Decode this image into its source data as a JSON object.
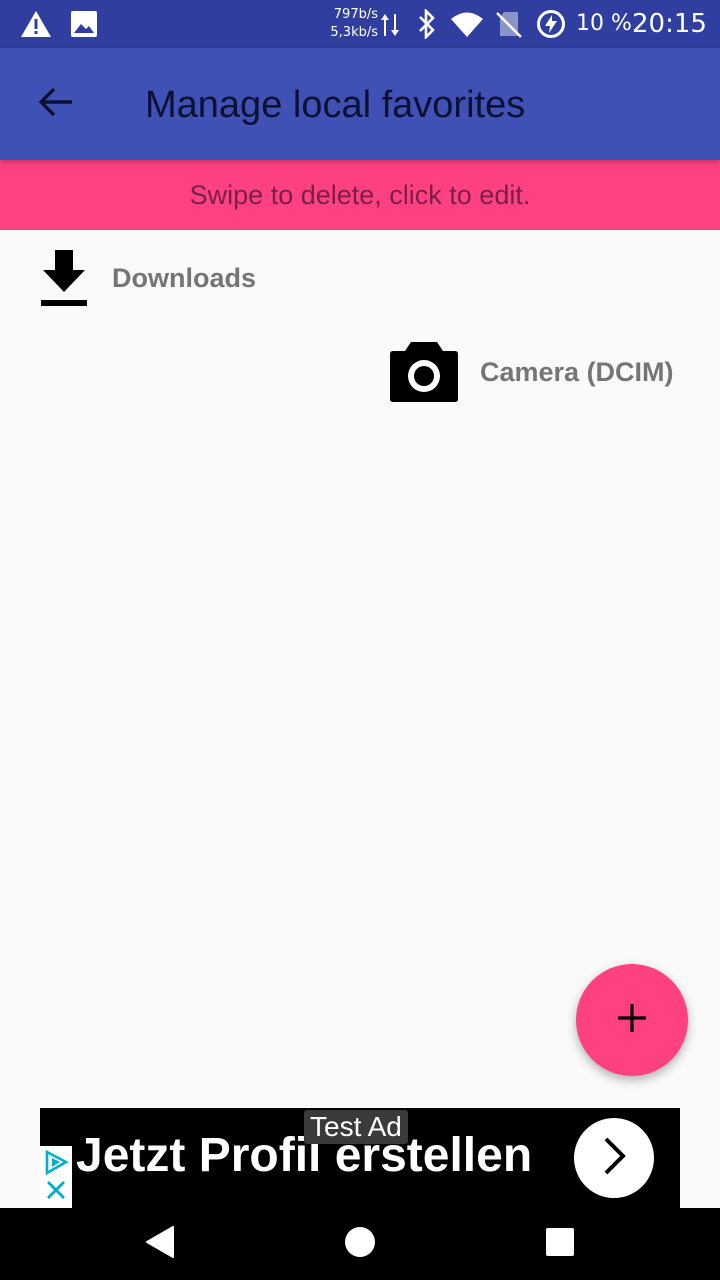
{
  "status_bar": {
    "net_down": "797b/s",
    "net_up": "5,3kb/s",
    "battery_percent": "10 %",
    "time": "20:15",
    "icons": [
      "warning-icon",
      "image-icon",
      "data-transfer-icon",
      "bluetooth-icon",
      "wifi-icon",
      "no-sim-icon",
      "battery-charging-icon"
    ]
  },
  "app_bar": {
    "title": "Manage local favorites",
    "back_icon": "arrow-back-icon"
  },
  "hint": {
    "text": "Swipe to delete, click to edit."
  },
  "favorites": [
    {
      "label": "Downloads",
      "icon": "download-icon"
    },
    {
      "label": "Camera (DCIM)",
      "icon": "camera-icon"
    }
  ],
  "fab": {
    "icon": "plus-icon"
  },
  "ad": {
    "label": "Test Ad",
    "headline": "Jetzt Profil erstellen",
    "choices_icon": "ad-choices-icon",
    "arrow_icon": "chevron-right-icon"
  },
  "nav_bar": {
    "buttons": [
      "back-triangle-icon",
      "home-circle-icon",
      "recents-square-icon"
    ]
  },
  "colors": {
    "status_bar": "#303f9f",
    "app_bar": "#3f51b5",
    "accent": "#ff4081",
    "background": "#fafafa",
    "label_gray": "#757575"
  }
}
